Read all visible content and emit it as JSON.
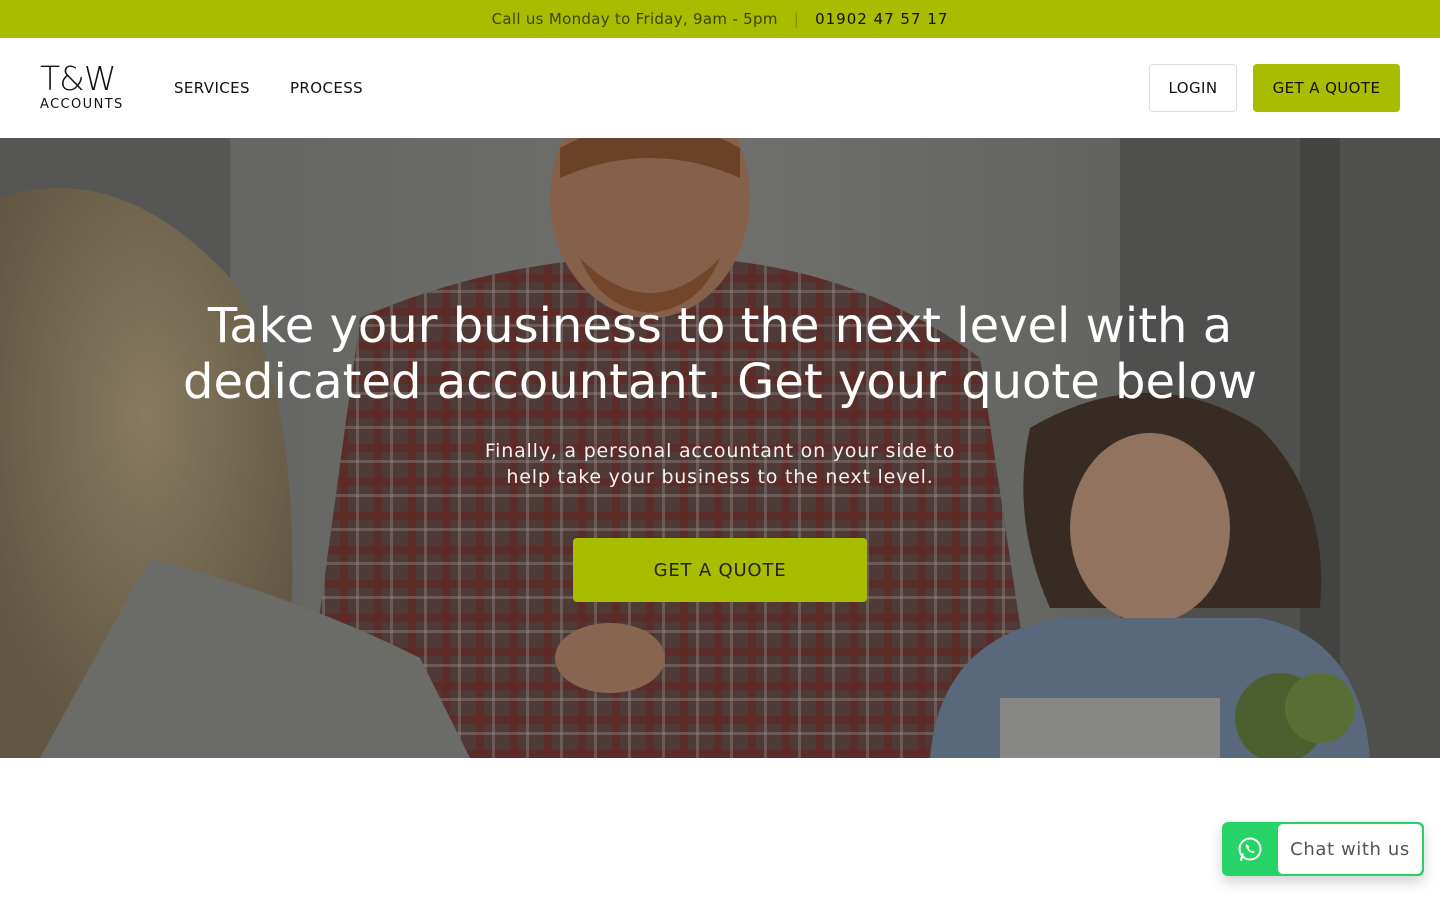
{
  "topbar": {
    "hours": "Call us Monday to Friday, 9am - 5pm",
    "separator": "|",
    "phone": "01902 47 57 17"
  },
  "header": {
    "logo_main": "T&W",
    "logo_sub": "ACCOUNTS",
    "nav": [
      {
        "label": "SERVICES"
      },
      {
        "label": "PROCESS"
      }
    ],
    "login_label": "LOGIN",
    "quote_label": "GET A QUOTE"
  },
  "hero": {
    "title": "Take your business to the next level with a dedicated accountant. Get your quote below",
    "subtitle": "Finally, a personal accountant on your side to help take your business to the next level.",
    "cta_label": "GET A QUOTE"
  },
  "chat": {
    "label": "Chat with us",
    "icon": "whatsapp-icon"
  },
  "colors": {
    "accent": "#a8bd00",
    "chat_green": "#25d366"
  }
}
